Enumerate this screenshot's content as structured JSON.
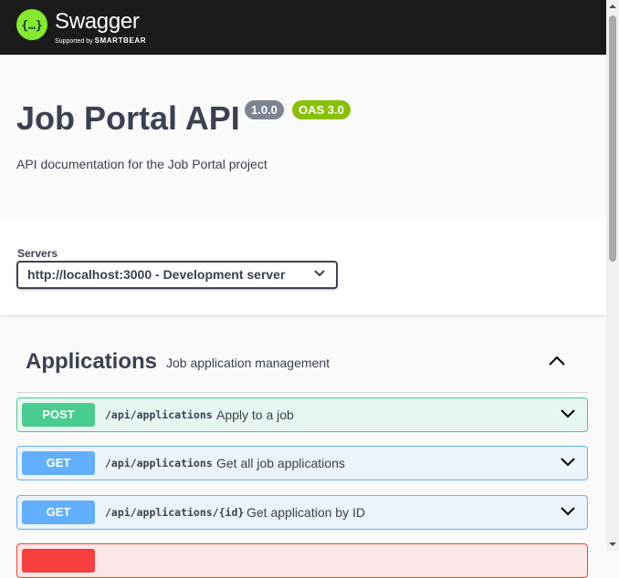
{
  "topbar": {
    "logo_text": "Swagger",
    "logo_sub_prefix": "Supported by",
    "logo_sub_brand": "SMARTBEAR",
    "logo_glyph": "{…}"
  },
  "info": {
    "title": "Job Portal API",
    "version": "1.0.0",
    "oas": "OAS 3.0",
    "description": "API documentation for the Job Portal project"
  },
  "servers": {
    "label": "Servers",
    "selected": "http://localhost:3000 - Development server"
  },
  "tag": {
    "name": "Applications",
    "description": "Job application management"
  },
  "operations": [
    {
      "method": "POST",
      "path": "/api/applications",
      "summary": "Apply to a job"
    },
    {
      "method": "GET",
      "path": "/api/applications",
      "summary": "Get all job applications"
    },
    {
      "method": "GET",
      "path": "/api/applications/{id}",
      "summary": "Get application by ID"
    },
    {
      "method": "",
      "path": "",
      "summary": ""
    }
  ],
  "colors": {
    "post": "#49cc90",
    "get": "#61affe",
    "delete": "#f93e3e",
    "badge_version": "#7d8492",
    "badge_oas": "#89bf04",
    "brand": "#85ea2d"
  }
}
